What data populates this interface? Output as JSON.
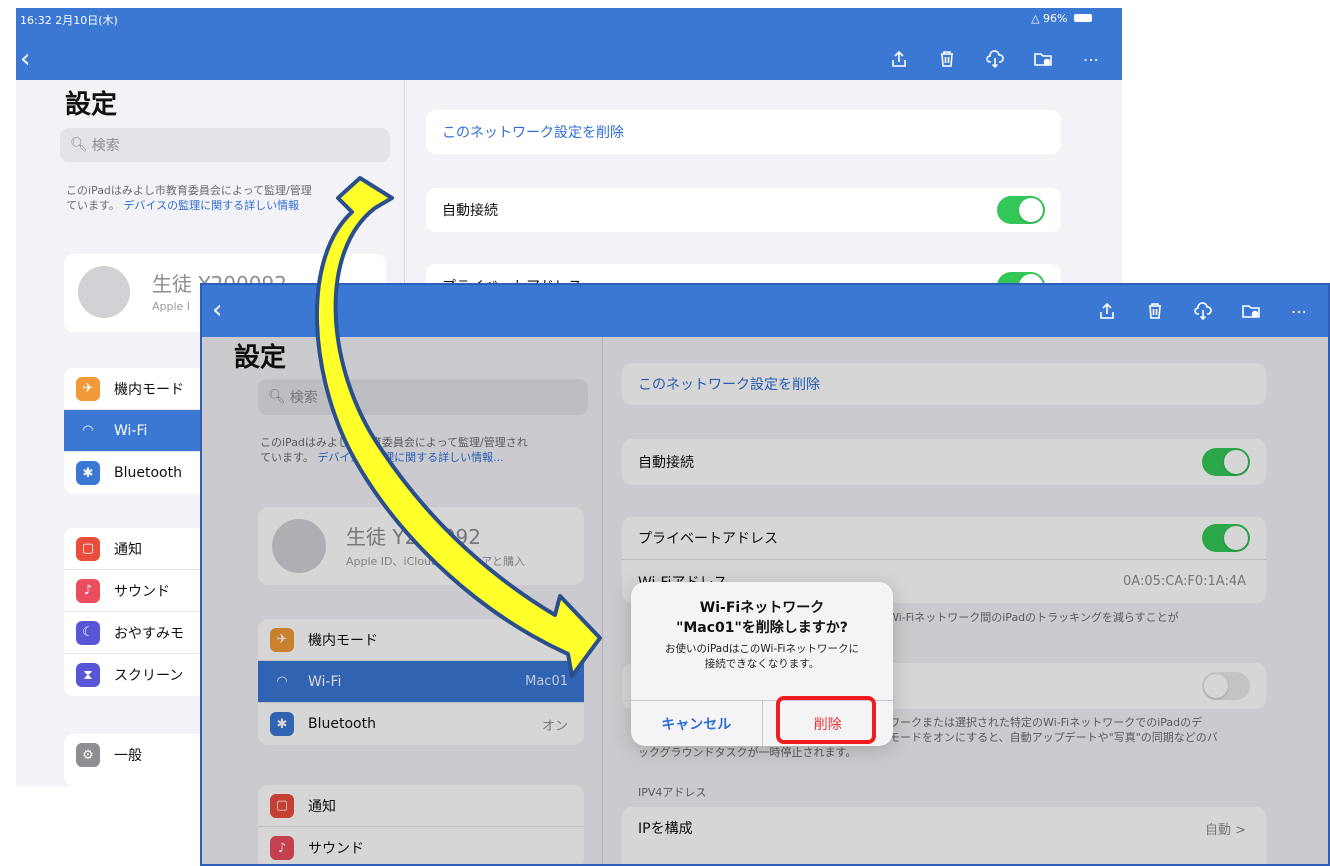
{
  "back_shot": {
    "status_time": "16:32  2月10日(木)",
    "status_battery": "96%",
    "sidebar": {
      "title": "設定",
      "search_placeholder": "検索",
      "supervision_note": "このiPadはみよし市教育委員会によって監理/管理",
      "supervision_note2": "ています。",
      "supervision_link": "デバイスの監理に関する詳しい情報",
      "profile_name": "生徒 Y200092",
      "profile_sub": "Apple I",
      "items_group1": [
        {
          "label": "機内モード",
          "icon": "airplane-icon",
          "color": "#f19a38"
        },
        {
          "label": "Wi-Fi",
          "icon": "wifi-icon",
          "color": "#3a78d4",
          "selected": true
        },
        {
          "label": "Bluetooth",
          "icon": "bluetooth-icon",
          "color": "#3a78d4"
        }
      ],
      "items_group2": [
        {
          "label": "通知",
          "icon": "notification-icon",
          "color": "#eb4d3d"
        },
        {
          "label": "サウンド",
          "icon": "sound-icon",
          "color": "#eb4d5e"
        },
        {
          "label": "おやすみモ",
          "icon": "moon-icon",
          "color": "#5856d6"
        },
        {
          "label": "スクリーン",
          "icon": "hourglass-icon",
          "color": "#5856d6"
        }
      ],
      "items_group3": [
        {
          "label": "一般",
          "icon": "gear-icon",
          "color": "#8e8e93"
        }
      ]
    },
    "detail": {
      "forget_network": "このネットワーク設定を削除",
      "auto_join": "自動接続",
      "private_address": "プライベートアドレス"
    }
  },
  "front_shot": {
    "sidebar": {
      "title": "設定",
      "search_placeholder": "検索",
      "supervision_note": "このiPadはみよし市教育委員会によって監理/管理され",
      "supervision_note2": "ています。",
      "supervision_link": "デバイスの監理に関する詳しい情報...",
      "profile_name": "生徒 Y200092",
      "profile_sub": "Apple ID、iCloud、メディアと購入",
      "items_group1": [
        {
          "label": "機内モード",
          "icon": "airplane-icon",
          "color": "#f19a38",
          "value": ""
        },
        {
          "label": "Wi-Fi",
          "icon": "wifi-icon",
          "color": "#3a78d4",
          "value": "Mac01",
          "selected": true
        },
        {
          "label": "Bluetooth",
          "icon": "bluetooth-icon",
          "color": "#3a78d4",
          "value": "オン"
        }
      ],
      "items_group2": [
        {
          "label": "通知",
          "icon": "notification-icon",
          "color": "#eb4d3d"
        },
        {
          "label": "サウンド",
          "icon": "sound-icon",
          "color": "#eb4d5e"
        }
      ]
    },
    "detail": {
      "forget_network": "このネットワーク設定を削除",
      "auto_join": "自動接続",
      "private_address": "プライベートアドレス",
      "wifi_address_label": "Wi-Fiアドレス",
      "wifi_address_value": "0A:05:CA:F0:1A:4A",
      "private_note": "Wi-Fiネットワーク間のiPadのトラッキングを減らすことが",
      "low_data_note1": "トワークまたは選択された特定のWi-FiネットワークでのiPadのデ",
      "low_data_note2": "タモードをオンにすると、自動アップデートや\"写真\"の同期などのバ",
      "low_data_note3": "ックグラウンドタスクが一時停止されます。",
      "ipv4_header": "IPV4アドレス",
      "configure_ip": "IPを構成",
      "configure_ip_value": "自動 >"
    },
    "alert": {
      "title_line1": "Wi-Fiネットワーク",
      "title_line2": "\"Mac01\"を削除しますか?",
      "message_line1": "お使いのiPadはこのWi-Fiネットワークに",
      "message_line2": "接続できなくなります。",
      "cancel_label": "キャンセル",
      "delete_label": "削除"
    }
  },
  "colors": {
    "toolbar_blue": "#3a78d4",
    "toggle_green": "#34c759",
    "highlight_red": "#ef1d1d",
    "arrow_yellow": "#ffff2a",
    "arrow_outline": "#2a4f8c"
  }
}
